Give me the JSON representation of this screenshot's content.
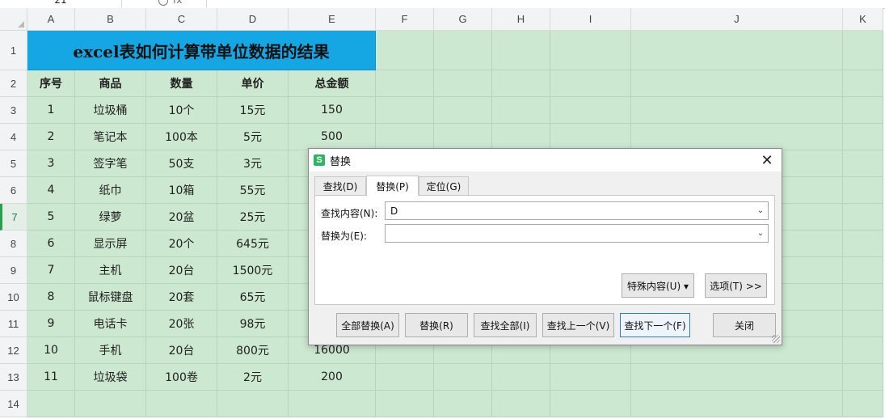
{
  "formula_bar": {
    "name_box": "21",
    "fx_glyph": "fx",
    "formula": ""
  },
  "columns": [
    "A",
    "B",
    "C",
    "D",
    "E",
    "F",
    "G",
    "H",
    "I",
    "J",
    "K"
  ],
  "rows": [
    "1",
    "2",
    "3",
    "4",
    "5",
    "6",
    "7",
    "8",
    "9",
    "10",
    "11",
    "12",
    "13",
    "14"
  ],
  "active_row": "7",
  "sheet": {
    "title": "excel表如何计算带单位数据的结果",
    "headers": [
      "序号",
      "商品",
      "数量",
      "单价",
      "总金额"
    ],
    "data": [
      [
        "1",
        "垃圾桶",
        "10个",
        "15元",
        "150"
      ],
      [
        "2",
        "笔记本",
        "100本",
        "5元",
        "500"
      ],
      [
        "3",
        "签字笔",
        "50支",
        "3元",
        ""
      ],
      [
        "4",
        "纸巾",
        "10箱",
        "55元",
        ""
      ],
      [
        "5",
        "绿萝",
        "20盆",
        "25元",
        ""
      ],
      [
        "6",
        "显示屏",
        "20个",
        "645元",
        ""
      ],
      [
        "7",
        "主机",
        "20台",
        "1500元",
        ""
      ],
      [
        "8",
        "鼠标键盘",
        "20套",
        "65元",
        ""
      ],
      [
        "9",
        "电话卡",
        "20张",
        "98元",
        ""
      ],
      [
        "10",
        "手机",
        "20台",
        "800元",
        "16000"
      ],
      [
        "11",
        "垃圾袋",
        "100卷",
        "2元",
        "200"
      ]
    ]
  },
  "dialog": {
    "app_icon": "S",
    "title": "替换",
    "close_glyph": "✕",
    "tabs": [
      "查找(D)",
      "替换(P)",
      "定位(G)"
    ],
    "selected_tab": "替换(P)",
    "find_label": "查找内容(N):",
    "find_value": "D",
    "replace_label": "替换为(E):",
    "replace_value": "",
    "special_button": "特殊内容(U) ▾",
    "options_button": "选项(T) >>",
    "buttons": {
      "replace_all": "全部替换(A)",
      "replace": "替换(R)",
      "find_all": "查找全部(I)",
      "find_prev": "查找上一个(V)",
      "find_next": "查找下一个(F)",
      "close": "关闭"
    }
  },
  "colors": {
    "cell_fill": "#cde8d1",
    "title_fill": "#14a7e4",
    "header_fill": "#f1f3f5",
    "accent": "#2a9d4f"
  }
}
